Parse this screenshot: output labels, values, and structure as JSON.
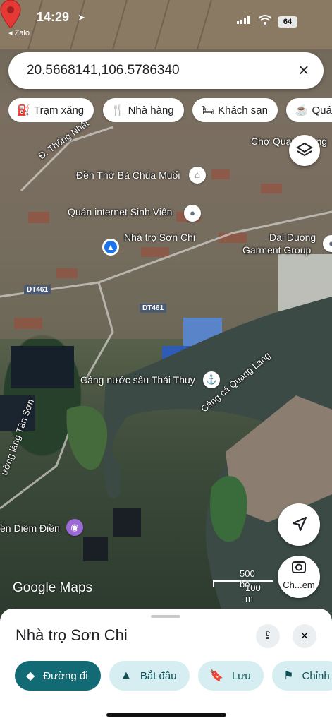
{
  "status_bar": {
    "time": "14:29",
    "back_app": "◂ Zalo",
    "battery": "64"
  },
  "search": {
    "query": "20.5668141,106.5786340"
  },
  "chips": [
    {
      "icon": "gas-station-icon",
      "label": "Trạm xăng"
    },
    {
      "icon": "restaurant-icon",
      "label": "Nhà hàng"
    },
    {
      "icon": "hotel-icon",
      "label": "Khách sạn"
    },
    {
      "icon": "coffee-icon",
      "label": "Quán"
    }
  ],
  "map": {
    "labels": {
      "road_thong_nhat": "Đ. Thống Nhất",
      "cho_quang_lang": "Chợ Quang Lang",
      "den_tho": "Đền Thờ Bà Chúa Muối",
      "quan_internet": "Quán internet Sinh Viên",
      "nha_tro": "Nhà trọ Sơn Chi",
      "dai_duong": "Dai Duong",
      "garment": "Garment Group",
      "dt461_a": "DT461",
      "dt461_b": "DT461",
      "cang_nuoc_sau": "Cảng nước sâu Thái Thụy",
      "cang_ca": "Cảng cá Quang Lang",
      "duong_lang": "ường làng Tân Sơn",
      "diem_dien": "ền Diêm Điền"
    },
    "scale": {
      "top": "500 bộ",
      "bottom": "100 m"
    },
    "logo": "Google Maps",
    "lens_label": "Ch...em"
  },
  "sheet": {
    "title": "Nhà trọ Sơn Chi",
    "actions": [
      {
        "icon": "directions-icon",
        "label": "Đường đi"
      },
      {
        "icon": "navigation-arrow-icon",
        "label": "Bắt đầu"
      },
      {
        "icon": "bookmark-icon",
        "label": "Lưu"
      },
      {
        "icon": "flag-icon",
        "label": "Chỉnh"
      }
    ]
  },
  "colors": {
    "primary_action": "#126b74",
    "secondary_action": "#d6eef1",
    "pin": "#e53935",
    "blue_dot": "#1a73e8"
  }
}
